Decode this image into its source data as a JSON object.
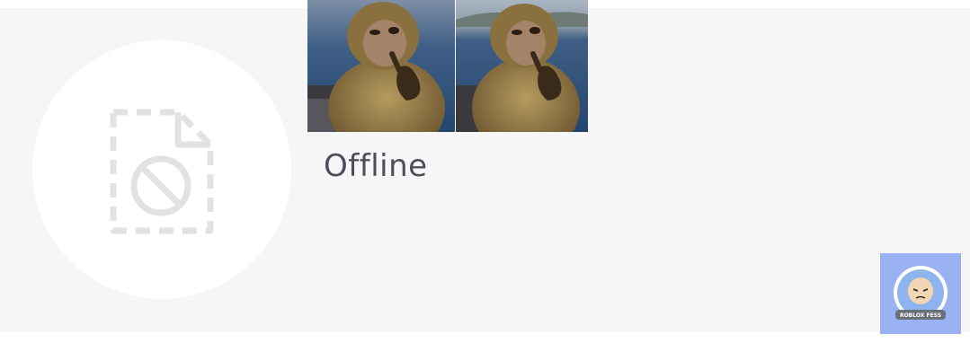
{
  "profile": {
    "placeholder_icon": "blocked-file-icon",
    "status": "Offline"
  },
  "images": [
    {
      "icon": "monkey-photo",
      "description": ""
    },
    {
      "icon": "monkey-photo",
      "description": ""
    }
  ],
  "badge": {
    "icon": "roblox-fess-mascot-icon",
    "label": "ROBLOX FESS"
  },
  "colors": {
    "background": "#f6f6f6",
    "status_text": "#4c4f5a",
    "badge_bg": "#9ab1f4"
  }
}
